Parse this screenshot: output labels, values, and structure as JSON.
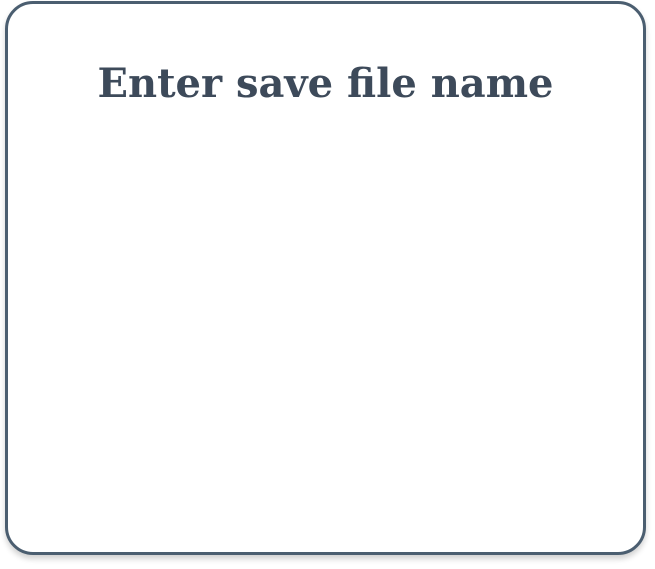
{
  "dialog": {
    "title": "Enter save file name",
    "border_color": "#4b5e70",
    "title_color": "#3d4a5a",
    "background_color": "#ffffff"
  }
}
